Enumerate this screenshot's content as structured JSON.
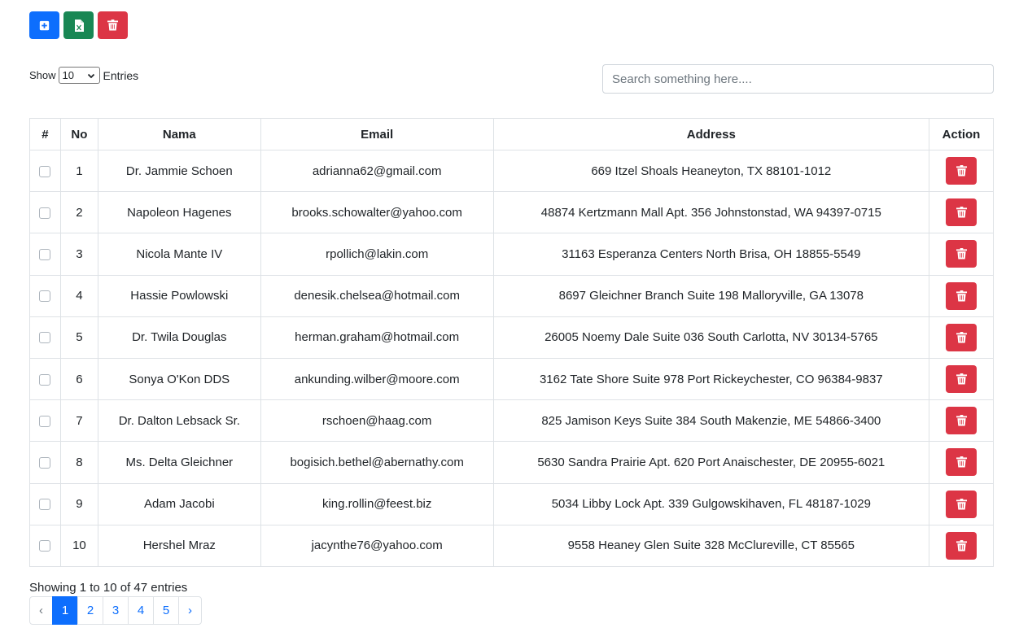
{
  "toolbar": {
    "add_icon": "plus-square-icon",
    "export_icon": "excel-file-icon",
    "delete_icon": "trash-icon",
    "colors": {
      "primary": "#0d6efd",
      "success": "#198754",
      "danger": "#dc3545"
    }
  },
  "length": {
    "prefix": "Show",
    "value": "10",
    "suffix": "Entries"
  },
  "search": {
    "placeholder": "Search something here...."
  },
  "table": {
    "headers": [
      "#",
      "No",
      "Nama",
      "Email",
      "Address",
      "Action"
    ],
    "rows": [
      {
        "no": "1",
        "nama": "Dr. Jammie Schoen",
        "email": "adrianna62@gmail.com",
        "address": "669 Itzel Shoals Heaneyton, TX 88101-1012"
      },
      {
        "no": "2",
        "nama": "Napoleon Hagenes",
        "email": "brooks.schowalter@yahoo.com",
        "address": "48874 Kertzmann Mall Apt. 356 Johnstonstad, WA 94397-0715"
      },
      {
        "no": "3",
        "nama": "Nicola Mante IV",
        "email": "rpollich@lakin.com",
        "address": "31163 Esperanza Centers North Brisa, OH 18855-5549"
      },
      {
        "no": "4",
        "nama": "Hassie Powlowski",
        "email": "denesik.chelsea@hotmail.com",
        "address": "8697 Gleichner Branch Suite 198 Malloryville, GA 13078"
      },
      {
        "no": "5",
        "nama": "Dr. Twila Douglas",
        "email": "herman.graham@hotmail.com",
        "address": "26005 Noemy Dale Suite 036 South Carlotta, NV 30134-5765"
      },
      {
        "no": "6",
        "nama": "Sonya O'Kon DDS",
        "email": "ankunding.wilber@moore.com",
        "address": "3162 Tate Shore Suite 978 Port Rickeychester, CO 96384-9837"
      },
      {
        "no": "7",
        "nama": "Dr. Dalton Lebsack Sr.",
        "email": "rschoen@haag.com",
        "address": "825 Jamison Keys Suite 384 South Makenzie, ME 54866-3400"
      },
      {
        "no": "8",
        "nama": "Ms. Delta Gleichner",
        "email": "bogisich.bethel@abernathy.com",
        "address": "5630 Sandra Prairie Apt. 620 Port Anaischester, DE 20955-6021"
      },
      {
        "no": "9",
        "nama": "Adam Jacobi",
        "email": "king.rollin@feest.biz",
        "address": "5034 Libby Lock Apt. 339 Gulgowskihaven, FL 48187-1029"
      },
      {
        "no": "10",
        "nama": "Hershel Mraz",
        "email": "jacynthe76@yahoo.com",
        "address": "9558 Heaney Glen Suite 328 McClureville, CT 85565"
      }
    ]
  },
  "info": "Showing 1 to 10 of 47 entries",
  "pagination": {
    "prev": "‹",
    "pages": [
      "1",
      "2",
      "3",
      "4",
      "5"
    ],
    "next": "›",
    "current": "1"
  }
}
